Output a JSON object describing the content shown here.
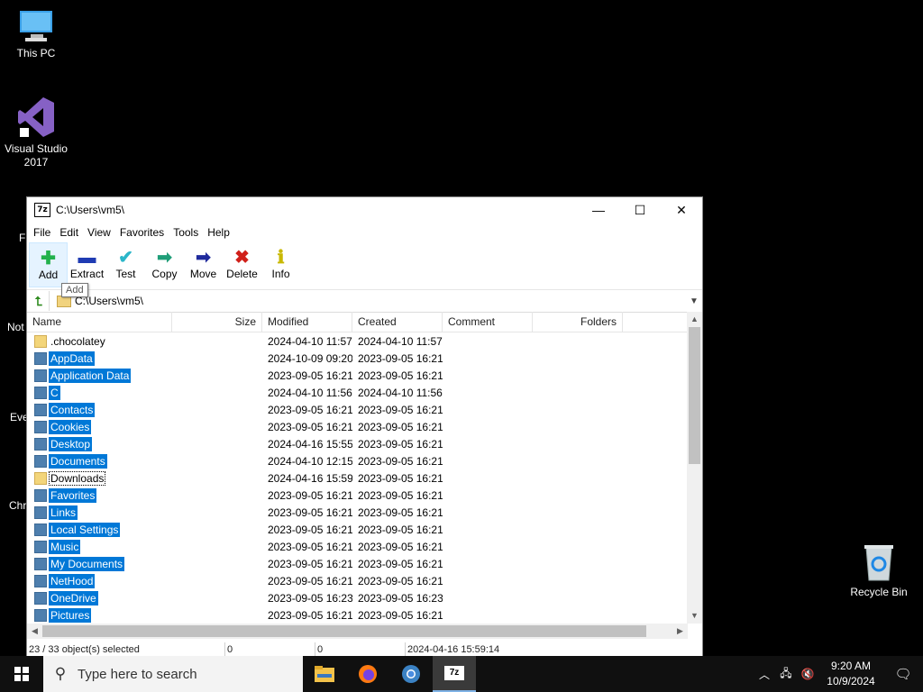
{
  "desktop": {
    "icons": [
      {
        "label": "This PC"
      },
      {
        "label": "Visual Studio 2017"
      },
      {
        "label": "Recycle Bin"
      }
    ],
    "partial_labels": [
      "F",
      "Not",
      "Eve",
      "Chr"
    ]
  },
  "window": {
    "title": "C:\\Users\\vm5\\",
    "app_icon_text": "7z",
    "controls": {
      "minimize": "—",
      "maximize": "☐",
      "close": "✕"
    },
    "menu": [
      "File",
      "Edit",
      "View",
      "Favorites",
      "Tools",
      "Help"
    ],
    "toolbar": [
      {
        "label": "Add",
        "icon": "plus-icon",
        "color": "#22b14c",
        "glyph": "✚"
      },
      {
        "label": "Extract",
        "icon": "minus-icon",
        "color": "#1f3bb3",
        "glyph": "▬"
      },
      {
        "label": "Test",
        "icon": "check-icon",
        "color": "#2bb6c9",
        "glyph": "✔"
      },
      {
        "label": "Copy",
        "icon": "double-arrow-icon",
        "color": "#1f9e78",
        "glyph": "➡"
      },
      {
        "label": "Move",
        "icon": "arrow-right-icon",
        "color": "#1f2a9c",
        "glyph": "➡"
      },
      {
        "label": "Delete",
        "icon": "x-icon",
        "color": "#d0201a",
        "glyph": "✖"
      },
      {
        "label": "Info",
        "icon": "info-icon",
        "color": "#c8b800",
        "glyph": "ℹ"
      }
    ],
    "tooltip": "Add",
    "address": "C:\\Users\\vm5\\",
    "columns": [
      "Name",
      "Size",
      "Modified",
      "Created",
      "Comment",
      "Folders"
    ],
    "files": [
      {
        "name": ".chocolatey",
        "modified": "2024-04-10 11:57",
        "created": "2024-04-10 11:57",
        "selected": false
      },
      {
        "name": "AppData",
        "modified": "2024-10-09 09:20",
        "created": "2023-09-05 16:21",
        "selected": true
      },
      {
        "name": "Application Data",
        "modified": "2023-09-05 16:21",
        "created": "2023-09-05 16:21",
        "selected": true
      },
      {
        "name": "C",
        "modified": "2024-04-10 11:56",
        "created": "2024-04-10 11:56",
        "selected": true
      },
      {
        "name": "Contacts",
        "modified": "2023-09-05 16:21",
        "created": "2023-09-05 16:21",
        "selected": true
      },
      {
        "name": "Cookies",
        "modified": "2023-09-05 16:21",
        "created": "2023-09-05 16:21",
        "selected": true
      },
      {
        "name": "Desktop",
        "modified": "2024-04-16 15:55",
        "created": "2023-09-05 16:21",
        "selected": true
      },
      {
        "name": "Documents",
        "modified": "2024-04-10 12:15",
        "created": "2023-09-05 16:21",
        "selected": true
      },
      {
        "name": "Downloads",
        "modified": "2024-04-16 15:59",
        "created": "2023-09-05 16:21",
        "selected": false,
        "focused": true
      },
      {
        "name": "Favorites",
        "modified": "2023-09-05 16:21",
        "created": "2023-09-05 16:21",
        "selected": true
      },
      {
        "name": "Links",
        "modified": "2023-09-05 16:21",
        "created": "2023-09-05 16:21",
        "selected": true
      },
      {
        "name": "Local Settings",
        "modified": "2023-09-05 16:21",
        "created": "2023-09-05 16:21",
        "selected": true
      },
      {
        "name": "Music",
        "modified": "2023-09-05 16:21",
        "created": "2023-09-05 16:21",
        "selected": true
      },
      {
        "name": "My Documents",
        "modified": "2023-09-05 16:21",
        "created": "2023-09-05 16:21",
        "selected": true
      },
      {
        "name": "NetHood",
        "modified": "2023-09-05 16:21",
        "created": "2023-09-05 16:21",
        "selected": true
      },
      {
        "name": "OneDrive",
        "modified": "2023-09-05 16:23",
        "created": "2023-09-05 16:23",
        "selected": true
      },
      {
        "name": "Pictures",
        "modified": "2023-09-05 16:21",
        "created": "2023-09-05 16:21",
        "selected": true
      }
    ],
    "status": [
      "23 / 33 object(s) selected",
      "0",
      "0",
      "2024-04-16 15:59:14"
    ]
  },
  "taskbar": {
    "search_placeholder": "Type here to search",
    "apps": [
      "file-explorer-icon",
      "firefox-icon",
      "chrome-icon",
      "7zip-icon"
    ],
    "time": "9:20 AM",
    "date": "10/9/2024",
    "selection_color": "#0078d7"
  }
}
